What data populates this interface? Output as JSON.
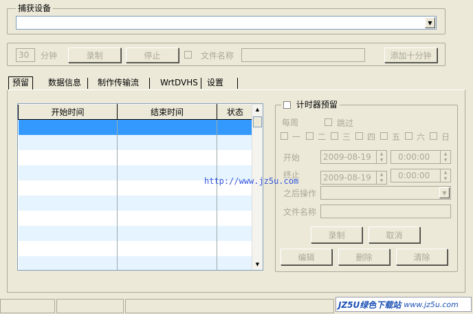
{
  "capture_device": {
    "title": "捕获设备",
    "device_value": ""
  },
  "record_bar": {
    "minutes_value": "30",
    "minutes_label": "分钟",
    "record_button": "录制",
    "stop_button": "停止",
    "filename_label": "文件名称",
    "filename_value": "",
    "add_ten_button": "添加十分钟"
  },
  "tabs": [
    {
      "label": "预留",
      "active": true
    },
    {
      "label": "数据信息",
      "active": false
    },
    {
      "label": "制作传输流",
      "active": false
    },
    {
      "label": "WrtDVHS",
      "active": false
    },
    {
      "label": "设置",
      "active": false
    }
  ],
  "schedule_table": {
    "columns": [
      "开始时间",
      "结束时间",
      "状态"
    ],
    "rows": []
  },
  "timer": {
    "title": "计时器预留",
    "weekly_label": "每周",
    "skip_label": "跳过",
    "days": [
      "一",
      "二",
      "三",
      "四",
      "五",
      "六",
      "日"
    ],
    "start_label": "开始",
    "start_date": "2009-08-19",
    "start_time": "0:00:00",
    "end_label": "终止",
    "end_date": "2009-08-19",
    "end_time": "0:00:00",
    "after_action_label": "之后操作",
    "after_action_value": "",
    "filename_label": "文件名称",
    "filename_value": "",
    "record_button": "录制",
    "cancel_button": "取消",
    "edit_button": "编辑",
    "delete_button": "删除",
    "clear_button": "清除"
  },
  "watermark_url": "http://www.jz5u.com",
  "brand": {
    "name": "JZ5U绿色下载站",
    "url": "www.jz5u.com"
  }
}
